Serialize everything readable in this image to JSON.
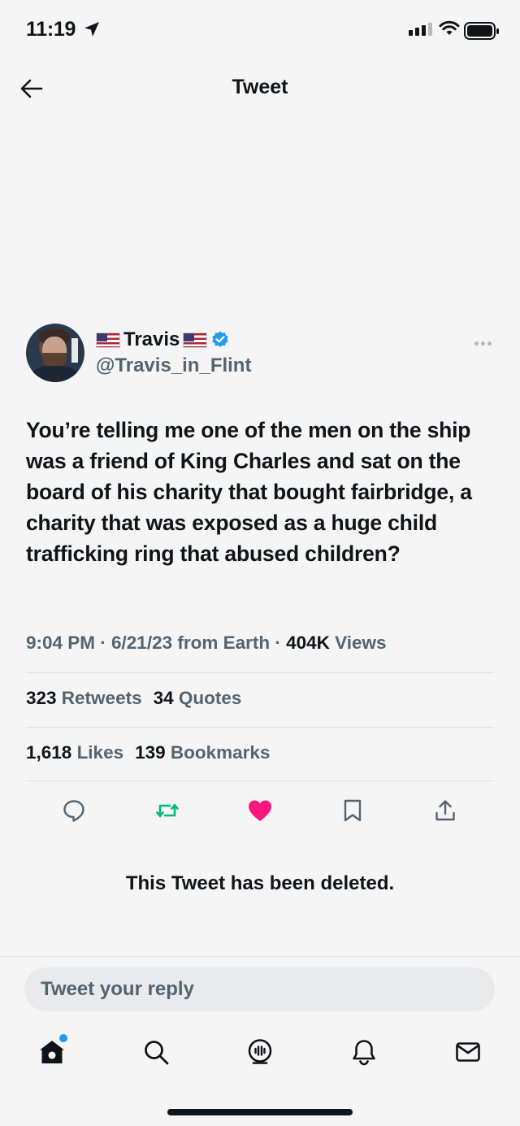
{
  "status_bar": {
    "time": "11:19",
    "icons": [
      "location-arrow-icon",
      "cellular-signal-icon",
      "wifi-icon",
      "battery-icon"
    ]
  },
  "header": {
    "title": "Tweet",
    "back_icon": "back-arrow-icon"
  },
  "tweet": {
    "author": {
      "name": "Travis",
      "name_flags": [
        "us-flag",
        "us-flag"
      ],
      "verified": true,
      "handle": "@Travis_in_Flint"
    },
    "text": "You’re telling me one of the men on the ship was a friend of King Charles and sat on the board of his charity that bought fairbridge, a charity that was exposed as a huge child trafficking ring that abused children?",
    "meta": {
      "timestamp": "9:04 PM · 6/21/23 from Earth · ",
      "views_count": "404K",
      "views_label": " Views"
    },
    "stats": {
      "retweets_count": "323",
      "retweets_label": " Retweets",
      "quotes_count": "34",
      "quotes_label": " Quotes",
      "likes_count": "1,618",
      "likes_label": " Likes",
      "bookmarks_count": "139",
      "bookmarks_label": " Bookmarks"
    },
    "actions": [
      "reply-icon",
      "retweet-icon",
      "like-icon",
      "bookmark-icon",
      "share-icon"
    ],
    "colors": {
      "retweet": "#00ba7c",
      "like": "#f91880",
      "verified": "#1d9bf0"
    }
  },
  "deleted_notice": "This Tweet has been deleted.",
  "reply_bar": {
    "placeholder": "Tweet your reply"
  },
  "bottom_nav": [
    "home-icon",
    "search-icon",
    "spaces-icon",
    "notifications-icon",
    "messages-icon"
  ]
}
